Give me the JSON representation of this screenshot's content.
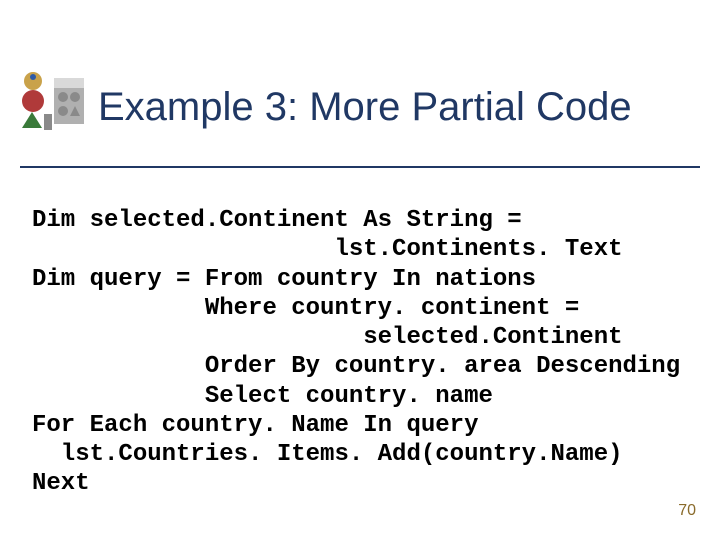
{
  "header": {
    "title": "Example 3: More Partial Code",
    "icon_name": "shapes-icon"
  },
  "code": {
    "lines": [
      "Dim selected.Continent As String =",
      "                     lst.Continents. Text",
      "Dim query = From country In nations",
      "            Where country. continent =",
      "                       selected.Continent",
      "            Order By country. area Descending",
      "            Select country. name",
      "For Each country. Name In query",
      "  lst.Countries. Items. Add(country.Name)",
      "Next"
    ]
  },
  "page_number": "70"
}
